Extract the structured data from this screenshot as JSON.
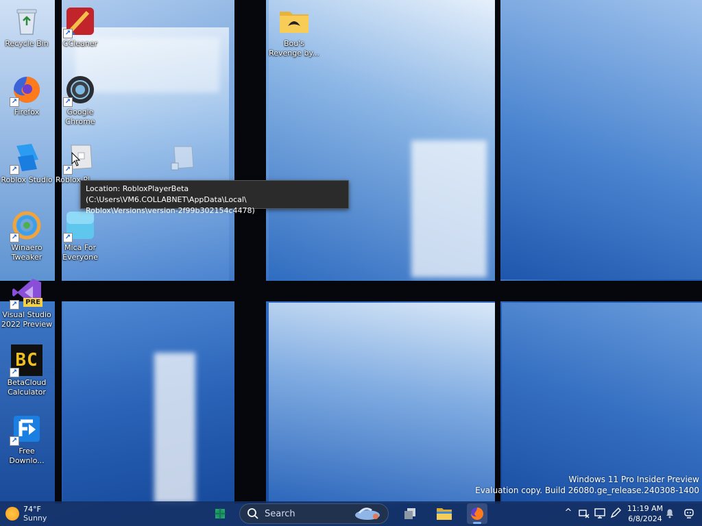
{
  "desktop": {
    "icons": [
      {
        "label": "Recycle Bin"
      },
      {
        "label": "CCleaner"
      },
      {
        "label": "Bou's Revenge by..."
      },
      {
        "label": "Firefox"
      },
      {
        "label": "Google Chrome"
      },
      {
        "label": "Roblox Studio"
      },
      {
        "label": "Roblox Pl..."
      },
      {
        "label": "Winaero Tweaker"
      },
      {
        "label": "Mica For Everyone"
      },
      {
        "label": "Visual Studio 2022 Preview"
      },
      {
        "label": "BetaCloud Calculator"
      },
      {
        "label": "Free Downlo..."
      }
    ],
    "tooltip": {
      "line1": "Location: RobloxPlayerBeta (C:\\Users\\VM6.COLLABNET\\AppData\\Local\\",
      "line2": "Roblox\\Versions\\version-2f99b302154c4478)"
    },
    "badge_pre": "PRE",
    "betacloud_glyph": "BC"
  },
  "watermark": {
    "line1": "Windows 11 Pro Insider Preview",
    "line2": "Evaluation copy. Build 26080.ge_release.240308-1400"
  },
  "taskbar": {
    "weather": {
      "temp": "74°F",
      "condition": "Sunny"
    },
    "search_placeholder": "Search",
    "apps": [
      "widgets-icon",
      "task-view-icon",
      "file-explorer-icon",
      "firefox-icon"
    ],
    "active_app": "firefox-icon",
    "tray": {
      "time": "11:19 AM",
      "date": "6/8/2024",
      "chevron": "^"
    }
  },
  "colors": {
    "taskbar": "#143064",
    "tooltip_bg": "#2b2b2b",
    "accent": "#1a5fd0"
  }
}
